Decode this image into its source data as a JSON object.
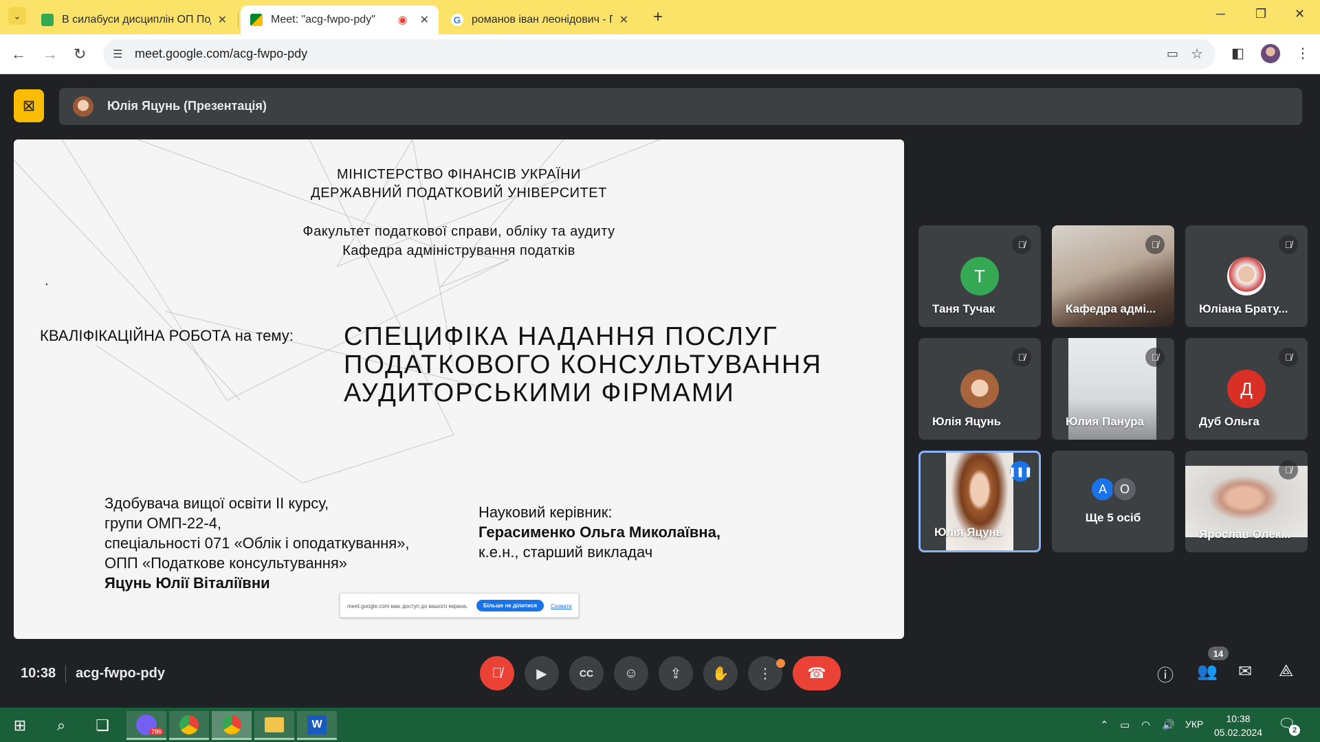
{
  "browser": {
    "tabs": [
      {
        "title": "В силабуси дисциплін ОП Под",
        "icon": "sheets-icon",
        "active": false
      },
      {
        "title": "Meet: \"acg-fwpo-pdy\"",
        "icon": "meet-icon",
        "active": true
      },
      {
        "title": "романов іван леонідович - Пош",
        "icon": "google-icon",
        "active": false
      }
    ],
    "url": "meet.google.com/acg-fwpo-pdy",
    "colors": {
      "frame": "#fbe36a",
      "recording": "#ea4335"
    }
  },
  "meet": {
    "presenter_label": "Юлія Яцунь (Презентація)",
    "time": "10:38",
    "meeting_code": "acg-fwpo-pdy",
    "participants_count": "14",
    "tiles": [
      {
        "name": "Таня Тучак",
        "letter": "T",
        "color": "#34a853",
        "muted": true
      },
      {
        "name": "Кафедра адмі...",
        "muted": true
      },
      {
        "name": "Юліана Брату...",
        "muted": true
      },
      {
        "name": "Юлія Яцунь",
        "muted": true
      },
      {
        "name": "Юлия Панура",
        "muted": true
      },
      {
        "name": "Дуб Ольга",
        "letter": "Д",
        "color": "#d93025",
        "muted": true
      },
      {
        "name": "Юлія Яцунь",
        "speaking": true
      },
      {
        "name": "Ще 5 осіб",
        "avatars": [
          "A",
          "O"
        ]
      },
      {
        "name": "Ярослав Олек...",
        "muted": true
      }
    ]
  },
  "slide": {
    "line1": "МІНІСТЕРСТВО ФІНАНСІВ УКРАЇНИ",
    "line2": "ДЕРЖАВНИЙ ПОДАТКОВИЙ УНІВЕРСИТЕТ",
    "line3": "Факультет податкової справи, обліку та аудиту",
    "line4": "Кафедра адміністрування податків",
    "dot": ".",
    "kval_label": "КВАЛІФІКАЦІЙНА РОБОТА на тему:",
    "topic1": "СПЕЦИФІКА НАДАННЯ ПОСЛУГ",
    "topic2": "ПОДАТКОВОГО КОНСУЛЬТУВАННЯ",
    "topic3": "АУДИТОРСЬКИМИ ФІРМАМИ",
    "student1": "Здобувача вищої освіти ІІ курсу,",
    "student2": "групи ОМП-22-4,",
    "student3": "спеціальності 071 «Облік і оподаткування»,",
    "student4": "ОПП «Податкове консультування»",
    "student5": "Яцунь Юлії Віталіївни",
    "sup1": "Науковий керівник:",
    "sup2": "Герасименко Ольга Миколаївна,",
    "sup3": "к.е.н., старший викладач",
    "share_msg": "meet.google.com має доступ до вашого екрана.",
    "share_stop": "Більше не ділитися",
    "share_hide": "Сховати"
  },
  "taskbar": {
    "viber_badge": "786",
    "lang": "УКР",
    "time": "10:38",
    "date": "05.02.2024",
    "notifications": "2",
    "color": "#1b5e3a"
  }
}
